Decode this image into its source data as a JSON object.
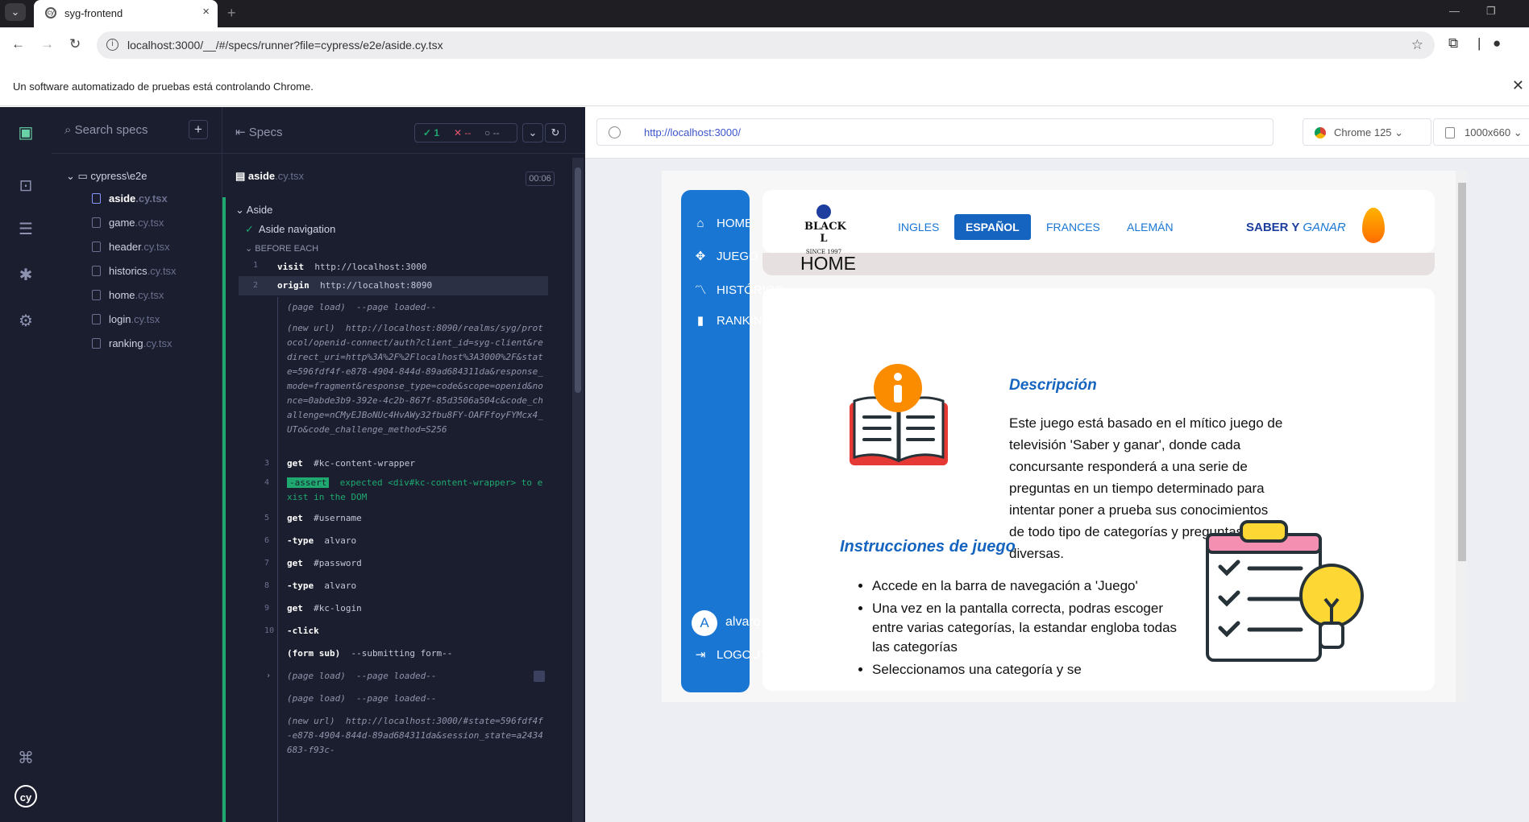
{
  "browser": {
    "tab_title": "syg-frontend",
    "url": "localhost:3000/__/#/specs/runner?file=cypress/e2e/aside.cy.tsx",
    "infobar_text": "Un software automatizado de pruebas está controlando Chrome."
  },
  "specs_panel": {
    "search_placeholder": "Search specs",
    "folder": "cypress\\e2e",
    "files": [
      {
        "name": "aside",
        "ext": ".cy.tsx"
      },
      {
        "name": "game",
        "ext": ".cy.tsx"
      },
      {
        "name": "header",
        "ext": ".cy.tsx"
      },
      {
        "name": "historics",
        "ext": ".cy.tsx"
      },
      {
        "name": "home",
        "ext": ".cy.tsx"
      },
      {
        "name": "login",
        "ext": ".cy.tsx"
      },
      {
        "name": "ranking",
        "ext": ".cy.tsx"
      }
    ]
  },
  "reporter": {
    "title": "Specs",
    "passed": "1",
    "failed": "--",
    "pending": "--",
    "spec_name": "aside",
    "spec_ext": ".cy.tsx",
    "duration": "00:06",
    "suite": "Aside",
    "test": "Aside navigation",
    "hook": "BEFORE EACH",
    "commands": [
      {
        "num": "1",
        "name": "visit",
        "msg": "http://localhost:3000"
      },
      {
        "num": "2",
        "name": "origin",
        "msg": "http://localhost:8090"
      },
      {
        "num": "",
        "name": "(page load)",
        "msg": "--page loaded--"
      },
      {
        "num": "",
        "name": "(new url)",
        "msg": "http://localhost:8090/realms/syg/protocol/openid-connect/auth?client_id=syg-client&redirect_uri=http%3A%2F%2Flocalhost%3A3000%2F&state=596fdf4f-e878-4904-844d-89ad684311da&response_mode=fragment&response_type=code&scope=openid&nonce=0abde3b9-392e-4c2b-867f-85d3506a504c&code_challenge=nCMyEJBoNUc4HvAWy32fbu8FY-OAFFfoyFYMcx4_UTo&code_challenge_method=S256"
      },
      {
        "num": "3",
        "name": "get",
        "msg": "#kc-content-wrapper"
      },
      {
        "num": "4",
        "name": "-assert",
        "msg": "expected <div#kc-content-wrapper> to exist in the DOM"
      },
      {
        "num": "5",
        "name": "get",
        "msg": "#username"
      },
      {
        "num": "6",
        "name": "-type",
        "msg": "alvaro"
      },
      {
        "num": "7",
        "name": "get",
        "msg": "#password"
      },
      {
        "num": "8",
        "name": "-type",
        "msg": "alvaro"
      },
      {
        "num": "9",
        "name": "get",
        "msg": "#kc-login"
      },
      {
        "num": "10",
        "name": "-click",
        "msg": ""
      },
      {
        "num": "",
        "name": "(form sub)",
        "msg": "--submitting form--",
        "count": "2"
      },
      {
        "num": "",
        "name": "(page load)",
        "msg": "--page loaded--"
      },
      {
        "num": "",
        "name": "(page load)",
        "msg": "--page loaded--"
      },
      {
        "num": "",
        "name": "(new url)",
        "msg": "http://localhost:3000/#state=596fdf4f-e878-4904-844d-89ad684311da&session_state=a2434683-f93c-"
      }
    ]
  },
  "aut": {
    "url": "http://localhost:3000/",
    "browser": "Chrome 125",
    "viewport": "1000x660"
  },
  "app": {
    "nav": [
      {
        "label": "HOME",
        "icon": "home-icon"
      },
      {
        "label": "JUEGO",
        "icon": "gamepad-icon"
      },
      {
        "label": "HISTÓRICO",
        "icon": "chart-line-icon"
      },
      {
        "label": "RANKING",
        "icon": "bar-chart-icon"
      }
    ],
    "user_initial": "A",
    "username": "alvaro",
    "logout": "LOGOUT",
    "logo_text": "BLACK L",
    "logo_sub": "SINCE 1997",
    "languages": [
      "INGLES",
      "ESPAÑOL",
      "FRANCES",
      "ALEMÁN"
    ],
    "active_language": "ESPAÑOL",
    "brand_a": "SABER Y",
    "brand_b": "GANAR",
    "page_title": "HOME",
    "description_title": "Descripción",
    "description_body": "Este juego está basado en el mítico juego de televisión 'Saber y ganar', donde cada concursante responderá a una serie de preguntas en un tiempo determinado para intentar poner a prueba sus conocimientos de todo tipo de categorías y preguntas diversas.",
    "instructions_title": "Instrucciones de juego",
    "instructions": [
      "Accede en la barra de navegación a 'Juego'",
      "Una vez en la pantalla correcta, podras escoger entre varias categorías, la estandar engloba todas las categorías",
      "Seleccionamos una categoría y se"
    ]
  }
}
